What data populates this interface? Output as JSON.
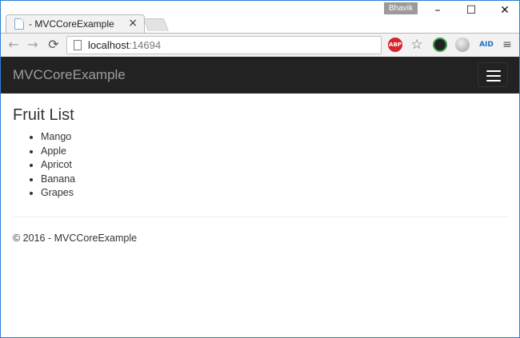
{
  "browser": {
    "tab_title": "- MVCCoreExample",
    "tab_close": "×",
    "profile_name": "Bhavik",
    "window_controls": {
      "minimize": "–",
      "maximize": "☐",
      "close": "✕"
    },
    "nav": {
      "back": "←",
      "forward": "→",
      "reload": "⟳"
    },
    "url_host": "localhost",
    "url_port": ":14694",
    "extensions": {
      "abp": "ABP",
      "star": "☆",
      "aid": "AID",
      "menu": "≡"
    }
  },
  "navbar": {
    "brand": "MVCCoreExample"
  },
  "main": {
    "title": "Fruit List",
    "fruits": [
      "Mango",
      "Apple",
      "Apricot",
      "Banana",
      "Grapes"
    ]
  },
  "footer": {
    "text": "© 2016 - MVCCoreExample"
  },
  "colors": {
    "navbar_bg": "#222222",
    "brand_text": "#9d9d9d",
    "window_border": "#2b7fd6"
  }
}
